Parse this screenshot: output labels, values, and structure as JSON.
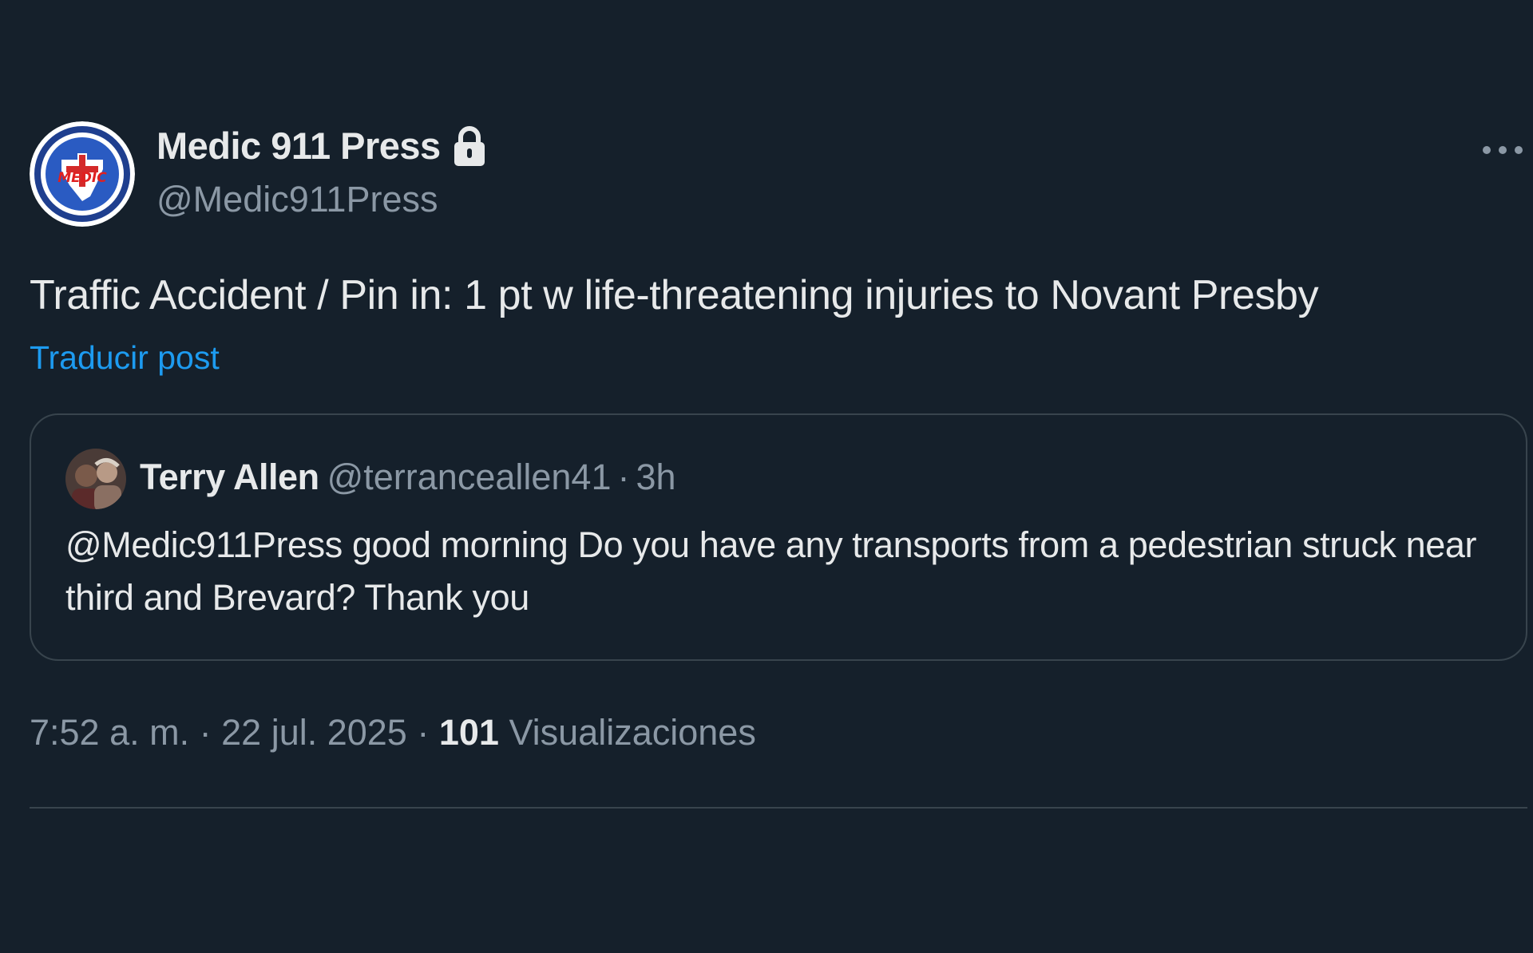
{
  "tweet": {
    "author": {
      "name": "Medic 911 Press",
      "handle": "@Medic911Press",
      "avatar_text": "MEDIC",
      "protected_icon": "lock-icon"
    },
    "more_icon": "more-horizontal-icon",
    "text": "Traffic Accident / Pin in: 1 pt w life-threatening injuries to Novant Presby",
    "translate_label": "Traducir post",
    "quote": {
      "name": "Terry Allen",
      "handle": "@terranceallen41",
      "separator": "·",
      "time": "3h",
      "text": "@Medic911Press good morning Do you have any transports from a pedestrian struck near third and Brevard? Thank you"
    },
    "meta": {
      "time": "7:52 a. m.",
      "separator": "·",
      "date": "22 jul. 2025",
      "views_count": "101",
      "views_label": "Visualizaciones"
    }
  },
  "colors": {
    "background": "#15202b",
    "text_primary": "#e7e9ea",
    "text_secondary": "#8b98a5",
    "link": "#1d9bf0",
    "border": "#38444d"
  }
}
